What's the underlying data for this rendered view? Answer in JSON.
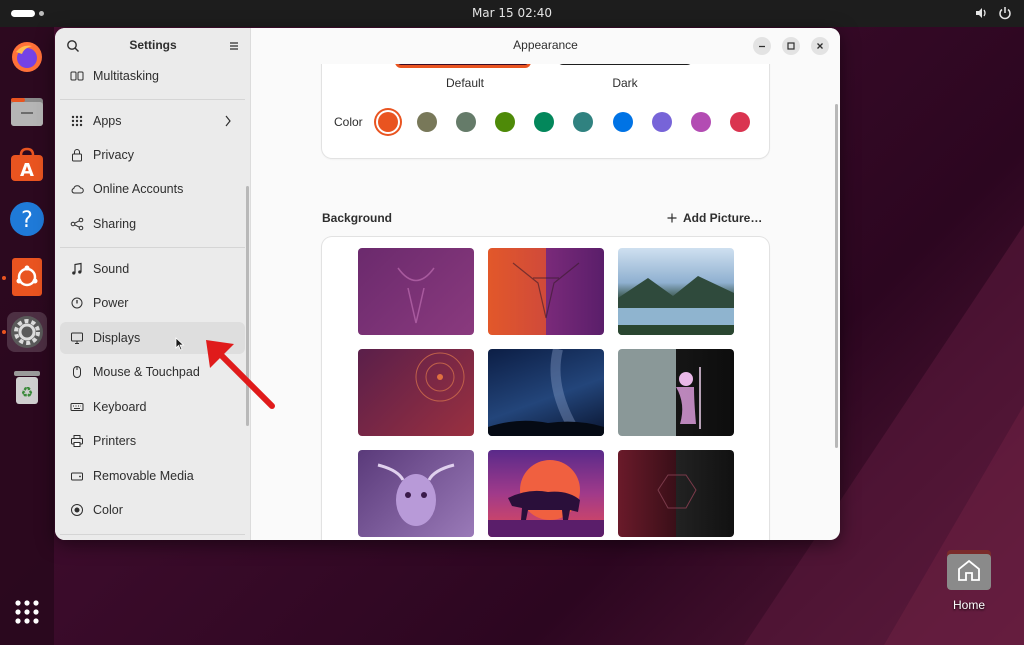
{
  "topbar": {
    "clock": "Mar 15  02:40"
  },
  "dock": {
    "items": [
      {
        "name": "firefox",
        "icon": "firefox-icon"
      },
      {
        "name": "files",
        "icon": "files-icon"
      },
      {
        "name": "app-center",
        "icon": "app-center-icon"
      },
      {
        "name": "help",
        "icon": "help-icon"
      },
      {
        "name": "ubuntu-installer",
        "icon": "ubuntu-icon"
      },
      {
        "name": "settings",
        "icon": "gear-icon"
      },
      {
        "name": "trash",
        "icon": "trash-icon"
      },
      {
        "name": "show-apps",
        "icon": "app-grid-icon"
      }
    ]
  },
  "desktop": {
    "home_label": "Home"
  },
  "settings": {
    "sidebar_title": "Settings",
    "items": [
      {
        "label": "Multitasking",
        "icon": "multitasking-icon"
      },
      {
        "label": "Apps",
        "icon": "apps-icon"
      },
      {
        "label": "Privacy",
        "icon": "lock-icon"
      },
      {
        "label": "Online Accounts",
        "icon": "cloud-icon"
      },
      {
        "label": "Sharing",
        "icon": "share-icon"
      },
      {
        "label": "Sound",
        "icon": "music-note-icon"
      },
      {
        "label": "Power",
        "icon": "power-icon"
      },
      {
        "label": "Displays",
        "icon": "monitor-icon"
      },
      {
        "label": "Mouse & Touchpad",
        "icon": "mouse-icon"
      },
      {
        "label": "Keyboard",
        "icon": "keyboard-icon"
      },
      {
        "label": "Printers",
        "icon": "printer-icon"
      },
      {
        "label": "Removable Media",
        "icon": "removable-media-icon"
      },
      {
        "label": "Color",
        "icon": "color-icon"
      }
    ],
    "hovered_item": "Displays"
  },
  "appearance": {
    "title": "Appearance",
    "styles": [
      {
        "label": "Default",
        "selected": true
      },
      {
        "label": "Dark",
        "selected": false
      }
    ],
    "color_label": "Color",
    "accent_colors": [
      "#e95420",
      "#787859",
      "#657b69",
      "#4e8a08",
      "#03875b",
      "#308280",
      "#0073e5",
      "#7764d8",
      "#b34cb3",
      "#da3450"
    ],
    "selected_accent": "#e95420",
    "background_label": "Background",
    "add_picture_label": "Add Picture…"
  },
  "colors": {
    "accent": "#e95420",
    "window_bg": "#fafafa",
    "sidebar_bg": "#ebebeb",
    "annotation_arrow": "#e01b1b"
  }
}
